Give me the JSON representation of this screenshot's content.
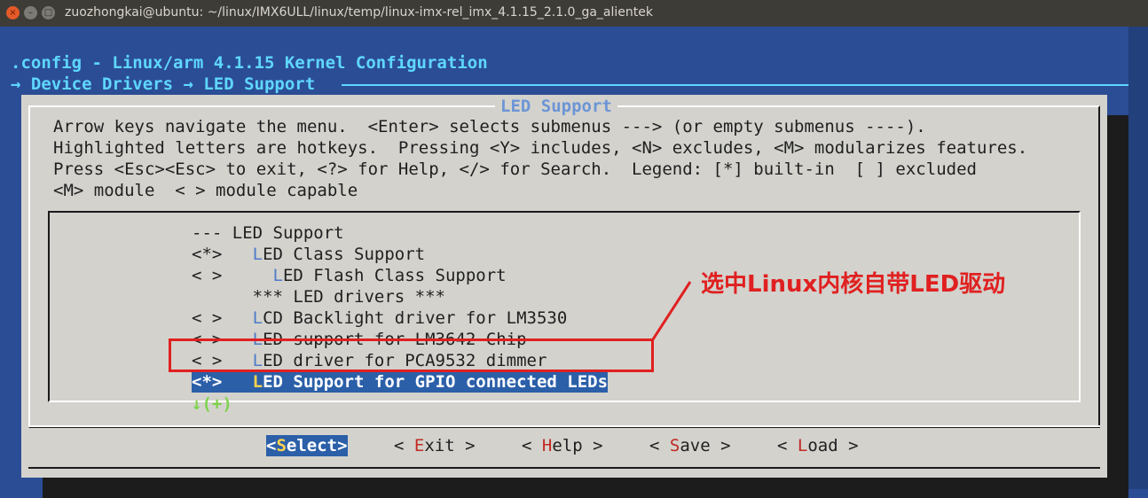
{
  "window": {
    "title": "zuozhongkai@ubuntu: ~/linux/IMX6ULL/linux/temp/linux-imx-rel_imx_4.1.15_2.1.0_ga_alientek",
    "close_glyph": "×",
    "min_glyph": "–",
    "max_glyph": "□"
  },
  "header": {
    "config_line": ".config - Linux/arm 4.1.15 Kernel Configuration",
    "path_line": "→ Device Drivers → LED Support"
  },
  "dialog": {
    "title": "LED Support",
    "help_lines": [
      "Arrow keys navigate the menu.  <Enter> selects submenus ---> (or empty submenus ----).",
      "Highlighted letters are hotkeys.  Pressing <Y> includes, <N> excludes, <M> modularizes features.",
      "Press <Esc><Esc> to exit, <?> for Help, </> for Search.  Legend: [*] built-in  [ ] excluded",
      "<M> module  < > module capable"
    ]
  },
  "menu": {
    "items": [
      {
        "prefix": "--- ",
        "hotkey": "",
        "rest": "LED Support"
      },
      {
        "prefix": "<*>   ",
        "hotkey": "L",
        "rest": "ED Class Support"
      },
      {
        "prefix": "< >     ",
        "hotkey": "L",
        "rest": "ED Flash Class Support"
      },
      {
        "prefix": "      ",
        "hotkey": "",
        "rest": "*** LED drivers ***"
      },
      {
        "prefix": "< >   ",
        "hotkey": "L",
        "rest": "CD Backlight driver for LM3530"
      },
      {
        "prefix": "< >   ",
        "hotkey": "L",
        "rest": "ED support for LM3642 Chip"
      },
      {
        "prefix": "< >   ",
        "hotkey": "L",
        "rest": "ED driver for PCA9532 dimmer"
      },
      {
        "prefix": "<*>   ",
        "hotkey": "L",
        "rest": "ED Support for GPIO connected LEDs"
      }
    ],
    "selected_index": 7,
    "more_indicator": "↓(+)"
  },
  "buttons": [
    {
      "open": "<",
      "hotkey": "S",
      "rest": "elect",
      "close": ">"
    },
    {
      "open": "< ",
      "hotkey": "E",
      "rest": "xit",
      "close": " >"
    },
    {
      "open": "< ",
      "hotkey": "H",
      "rest": "elp",
      "close": " >"
    },
    {
      "open": "< ",
      "hotkey": "S",
      "rest": "ave",
      "close": " >"
    },
    {
      "open": "< ",
      "hotkey": "L",
      "rest": "oad",
      "close": " >"
    }
  ],
  "annotation": {
    "text": "选中Linux内核自带LED驱动",
    "color": "#e02020"
  },
  "colors": {
    "terminal_bg": "#2b4d96",
    "dialog_bg": "#d3d2cd",
    "selection_bg": "#2b5fa8",
    "header_cyan": "#5fd7ff",
    "hotkey_blue": "#4f7bc8",
    "button_hotkey_red": "#c2281f"
  }
}
